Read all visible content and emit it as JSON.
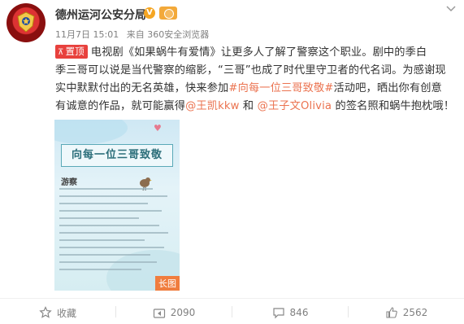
{
  "post": {
    "author": "德州运河公安分局",
    "timestamp": "11月7日 15:01",
    "source": "来自 360安全浏览器",
    "pinned_label": "置顶",
    "content": {
      "t1": "电视剧",
      "show_title": "《如果蜗牛有爱情》",
      "t2": "让更多人了解了警察这个职业。剧中的季白",
      "line2": "季三哥可以说是当代警察的缩影，“三哥”也成了时代里守卫者的代名词。为感谢现",
      "t3": "实中默默付出的无名英雄，快来参加",
      "hashtag": "#向每一位三哥致敬#",
      "t4": "活动吧，晒出你有创意",
      "t5": "有诚意的作品，就可能赢得",
      "mention1": "@王凯kkw",
      "t6": " 和 ",
      "mention2": "@王子文Olivia",
      "t7": " 的签名照和蜗牛抱枕哦！"
    },
    "image": {
      "banner_text": "向每一位三哥致敬",
      "subhead": "游察",
      "long_badge": "长图"
    }
  },
  "actions": {
    "favorite_label": "收藏",
    "repost_count": "2090",
    "comment_count": "846",
    "like_count": "2562"
  },
  "colors": {
    "link": "#eb7350",
    "pin_bg": "#e8413d",
    "vip_badge": "#f5a623"
  }
}
